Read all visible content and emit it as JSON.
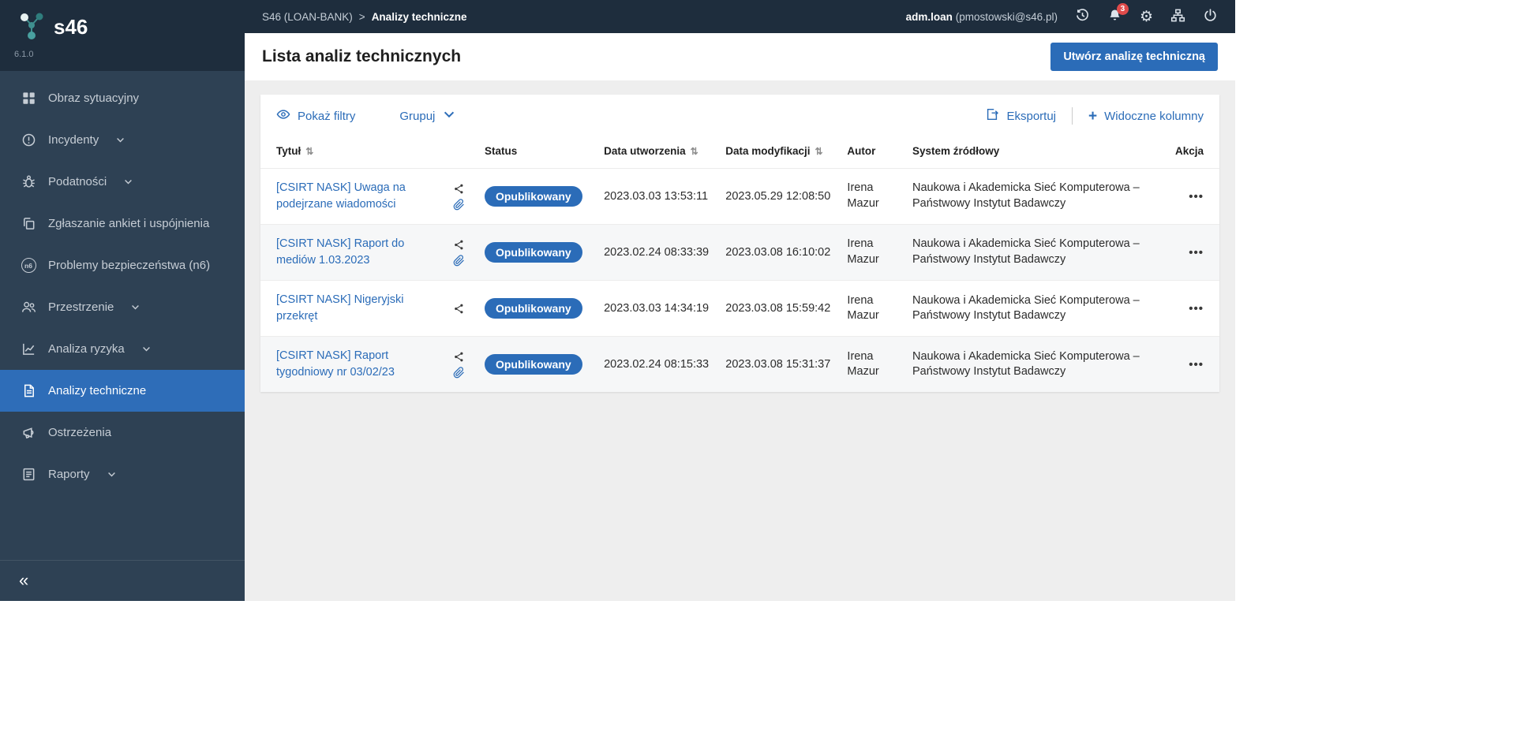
{
  "app": {
    "name": "s46",
    "version": "6.1.0"
  },
  "topbar": {
    "breadcrumb": {
      "root": "S46 (LOAN-BANK)",
      "separator": ">",
      "current": "Analizy techniczne"
    },
    "user_name": "adm.loan",
    "user_email": "(pmostowski@s46.pl)",
    "notifications_count": "3"
  },
  "sidebar": {
    "items": [
      {
        "label": "Obraz sytuacyjny",
        "expandable": false
      },
      {
        "label": "Incydenty",
        "expandable": true
      },
      {
        "label": "Podatności",
        "expandable": true
      },
      {
        "label": "Zgłaszanie ankiet i uspójnienia",
        "expandable": false
      },
      {
        "label": "Problemy bezpieczeństwa (n6)",
        "expandable": false
      },
      {
        "label": "Przestrzenie",
        "expandable": true
      },
      {
        "label": "Analiza ryzyka",
        "expandable": true
      },
      {
        "label": "Analizy techniczne",
        "expandable": false,
        "active": true
      },
      {
        "label": "Ostrzeżenia",
        "expandable": false
      },
      {
        "label": "Raporty",
        "expandable": true
      }
    ],
    "n6_icon_text": "n6",
    "collapse_icon": "«"
  },
  "page": {
    "title": "Lista analiz technicznych",
    "create_button": "Utwórz analizę techniczną"
  },
  "toolbar": {
    "show_filters": "Pokaż filtry",
    "group": "Grupuj",
    "export": "Eksportuj",
    "visible_columns": "Widoczne kolumny"
  },
  "table": {
    "columns": {
      "title": "Tytuł",
      "status": "Status",
      "created": "Data utworzenia",
      "modified": "Data modyfikacji",
      "author": "Autor",
      "source": "System źródłowy",
      "action": "Akcja"
    },
    "rows": [
      {
        "title": "[CSIRT NASK] Uwaga na podejrzane wiadomości",
        "status": "Opublikowany",
        "created": "2023.03.03 13:53:11",
        "modified": "2023.05.29 12:08:50",
        "author": "Irena Mazur",
        "source": "Naukowa i Akademicka Sieć Komputerowa – Państwowy Instytut Badawczy",
        "has_attachment": true
      },
      {
        "title": "[CSIRT NASK] Raport do mediów 1.03.2023",
        "status": "Opublikowany",
        "created": "2023.02.24 08:33:39",
        "modified": "2023.03.08 16:10:02",
        "author": "Irena Mazur",
        "source": "Naukowa i Akademicka Sieć Komputerowa – Państwowy Instytut Badawczy",
        "has_attachment": true
      },
      {
        "title": "[CSIRT NASK] Nigeryjski przekręt",
        "status": "Opublikowany",
        "created": "2023.03.03 14:34:19",
        "modified": "2023.03.08 15:59:42",
        "author": "Irena Mazur",
        "source": "Naukowa i Akademicka Sieć Komputerowa – Państwowy Instytut Badawczy",
        "has_attachment": false
      },
      {
        "title": "[CSIRT NASK] Raport tygodniowy nr 03/02/23",
        "status": "Opublikowany",
        "created": "2023.02.24 08:15:33",
        "modified": "2023.03.08 15:31:37",
        "author": "Irena Mazur",
        "source": "Naukowa i Akademicka Sieć Komputerowa – Państwowy Instytut Badawczy",
        "has_attachment": true
      }
    ]
  },
  "icons": {
    "sort": "⇅",
    "more": "•••",
    "gear": "⚙"
  },
  "colors": {
    "accent": "#2b6cb8",
    "topbar_bg": "#1e2d3d",
    "sidebar_bg": "#2e4154",
    "active_item_bg": "#2e6db8",
    "badge_red": "#e04b4b",
    "content_bg": "#eeeeee",
    "status_badge": "#2b6cb8"
  }
}
